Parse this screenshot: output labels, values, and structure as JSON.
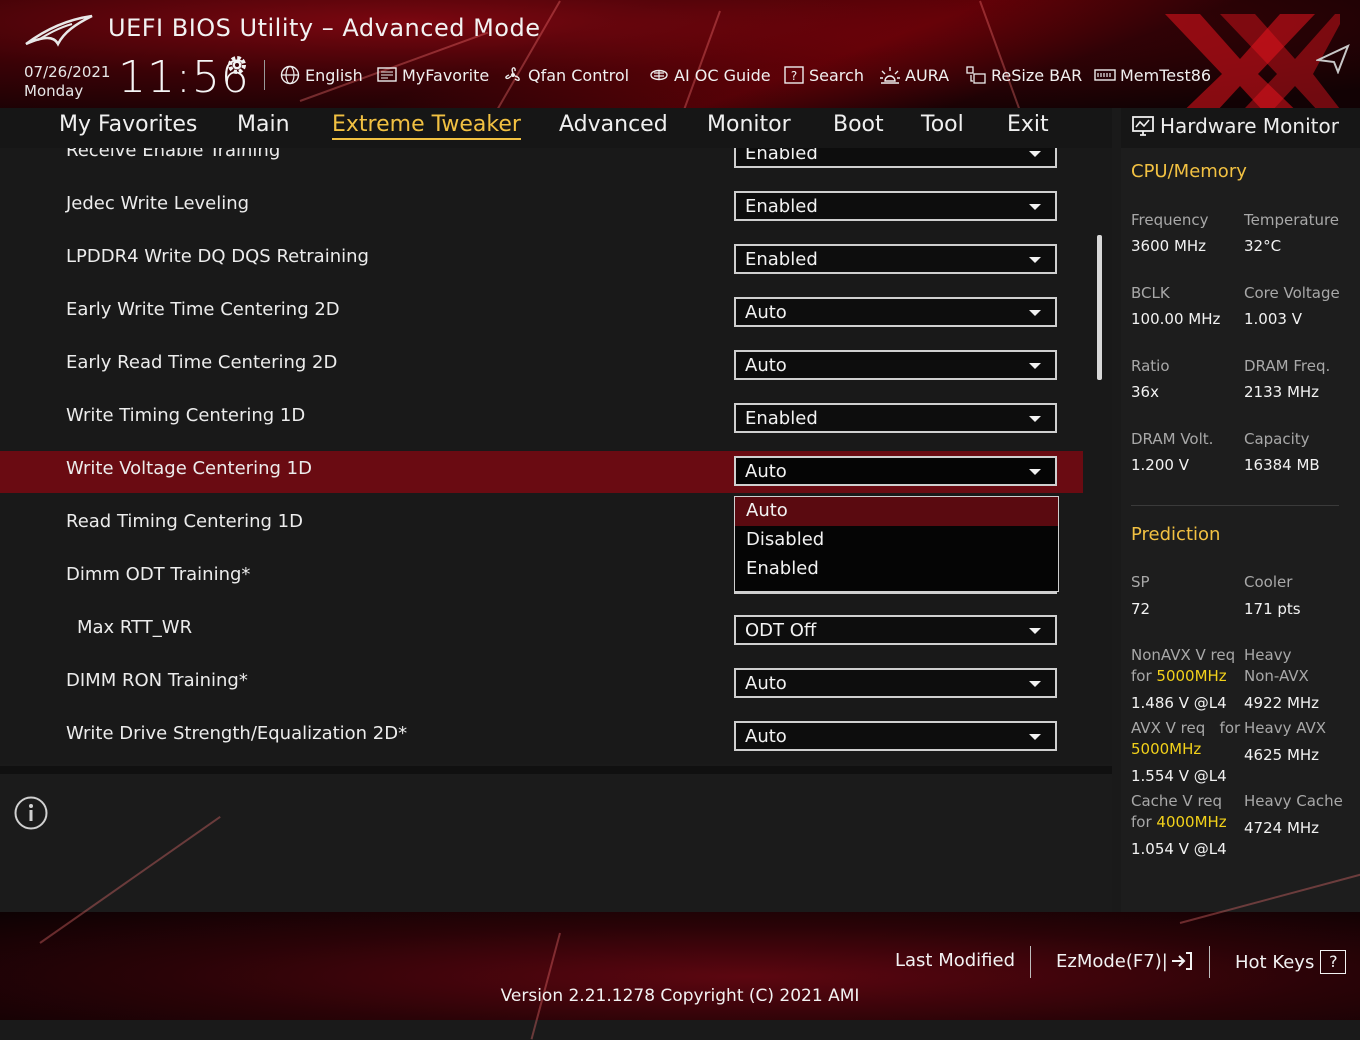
{
  "header": {
    "title": "UEFI BIOS Utility – Advanced Mode",
    "date": "07/26/2021",
    "weekday": "Monday",
    "time": "11:56",
    "tools": [
      {
        "label": "English",
        "icon": "globe-icon"
      },
      {
        "label": "MyFavorite",
        "icon": "favorite-icon"
      },
      {
        "label": "Qfan Control",
        "icon": "fan-icon"
      },
      {
        "label": "AI OC Guide",
        "icon": "ai-oc-icon"
      },
      {
        "label": "Search",
        "icon": "search-icon"
      },
      {
        "label": "AURA",
        "icon": "aura-icon"
      },
      {
        "label": "ReSize BAR",
        "icon": "resize-bar-icon"
      },
      {
        "label": "MemTest86",
        "icon": "memtest-icon"
      }
    ]
  },
  "nav": {
    "tabs": [
      "My Favorites",
      "Main",
      "Extreme Tweaker",
      "Advanced",
      "Monitor",
      "Boot",
      "Tool",
      "Exit"
    ],
    "active": "Extreme Tweaker"
  },
  "settings": [
    {
      "label": "Receive Enable Training",
      "value": "Enabled"
    },
    {
      "label": "Jedec Write Leveling",
      "value": "Enabled"
    },
    {
      "label": "LPDDR4 Write DQ DQS Retraining",
      "value": "Enabled"
    },
    {
      "label": "Early Write Time Centering 2D",
      "value": "Auto"
    },
    {
      "label": "Early Read Time Centering 2D",
      "value": "Auto"
    },
    {
      "label": "Write Timing Centering 1D",
      "value": "Enabled"
    },
    {
      "label": "Write Voltage Centering 1D",
      "value": "Auto"
    },
    {
      "label": "Read Timing Centering 1D",
      "value": ""
    },
    {
      "label": "Dimm ODT Training*",
      "value": ""
    },
    {
      "label": "Max RTT_WR",
      "value": "ODT Off"
    },
    {
      "label": "DIMM RON Training*",
      "value": "Auto"
    },
    {
      "label": "Write Drive Strength/Equalization 2D*",
      "value": "Auto"
    }
  ],
  "dropdown": {
    "options": [
      "Auto",
      "Disabled",
      "Enabled"
    ],
    "selected": "Auto"
  },
  "hw_monitor": {
    "title": "Hardware Monitor",
    "cpu_memory": {
      "heading": "CPU/Memory",
      "frequency_label": "Frequency",
      "frequency": "3600 MHz",
      "temperature_label": "Temperature",
      "temperature": "32°C",
      "bclk_label": "BCLK",
      "bclk": "100.00 MHz",
      "core_voltage_label": "Core Voltage",
      "core_voltage": "1.003 V",
      "ratio_label": "Ratio",
      "ratio": "36x",
      "dram_freq_label": "DRAM Freq.",
      "dram_freq": "2133 MHz",
      "dram_volt_label": "DRAM Volt.",
      "dram_volt": "1.200 V",
      "capacity_label": "Capacity",
      "capacity": "16384 MB"
    },
    "prediction": {
      "heading": "Prediction",
      "sp_label": "SP",
      "sp": "72",
      "cooler_label": "Cooler",
      "cooler": "171 pts",
      "nonavx_label_1": "NonAVX V req",
      "nonavx_for": "for",
      "nonavx_freq": "5000MHz",
      "nonavx_val": "1.486 V @L4",
      "heavy_nonavx_label_1": "Heavy",
      "heavy_nonavx_label_2": "Non-AVX",
      "heavy_nonavx_val": "4922 MHz",
      "avx_label_1": "AVX V req",
      "avx_for": "for",
      "avx_freq": "5000MHz",
      "avx_val": "1.554 V @L4",
      "heavy_avx_label": "Heavy AVX",
      "heavy_avx_val": "4625 MHz",
      "cache_label_1": "Cache V req",
      "cache_for": "for",
      "cache_freq": "4000MHz",
      "cache_val": "1.054 V @L4",
      "heavy_cache_label": "Heavy Cache",
      "heavy_cache_val": "4724 MHz"
    }
  },
  "footer": {
    "last_modified": "Last Modified",
    "ezmode": "EzMode(F7)|",
    "hot_keys": "Hot Keys",
    "hot_keys_key": "?",
    "version": "Version 2.21.1278 Copyright (C) 2021 AMI"
  },
  "colors": {
    "accent": "#f2c142",
    "highlight_row": "#6a0b12",
    "freq_yellow": "#f2d11a"
  }
}
